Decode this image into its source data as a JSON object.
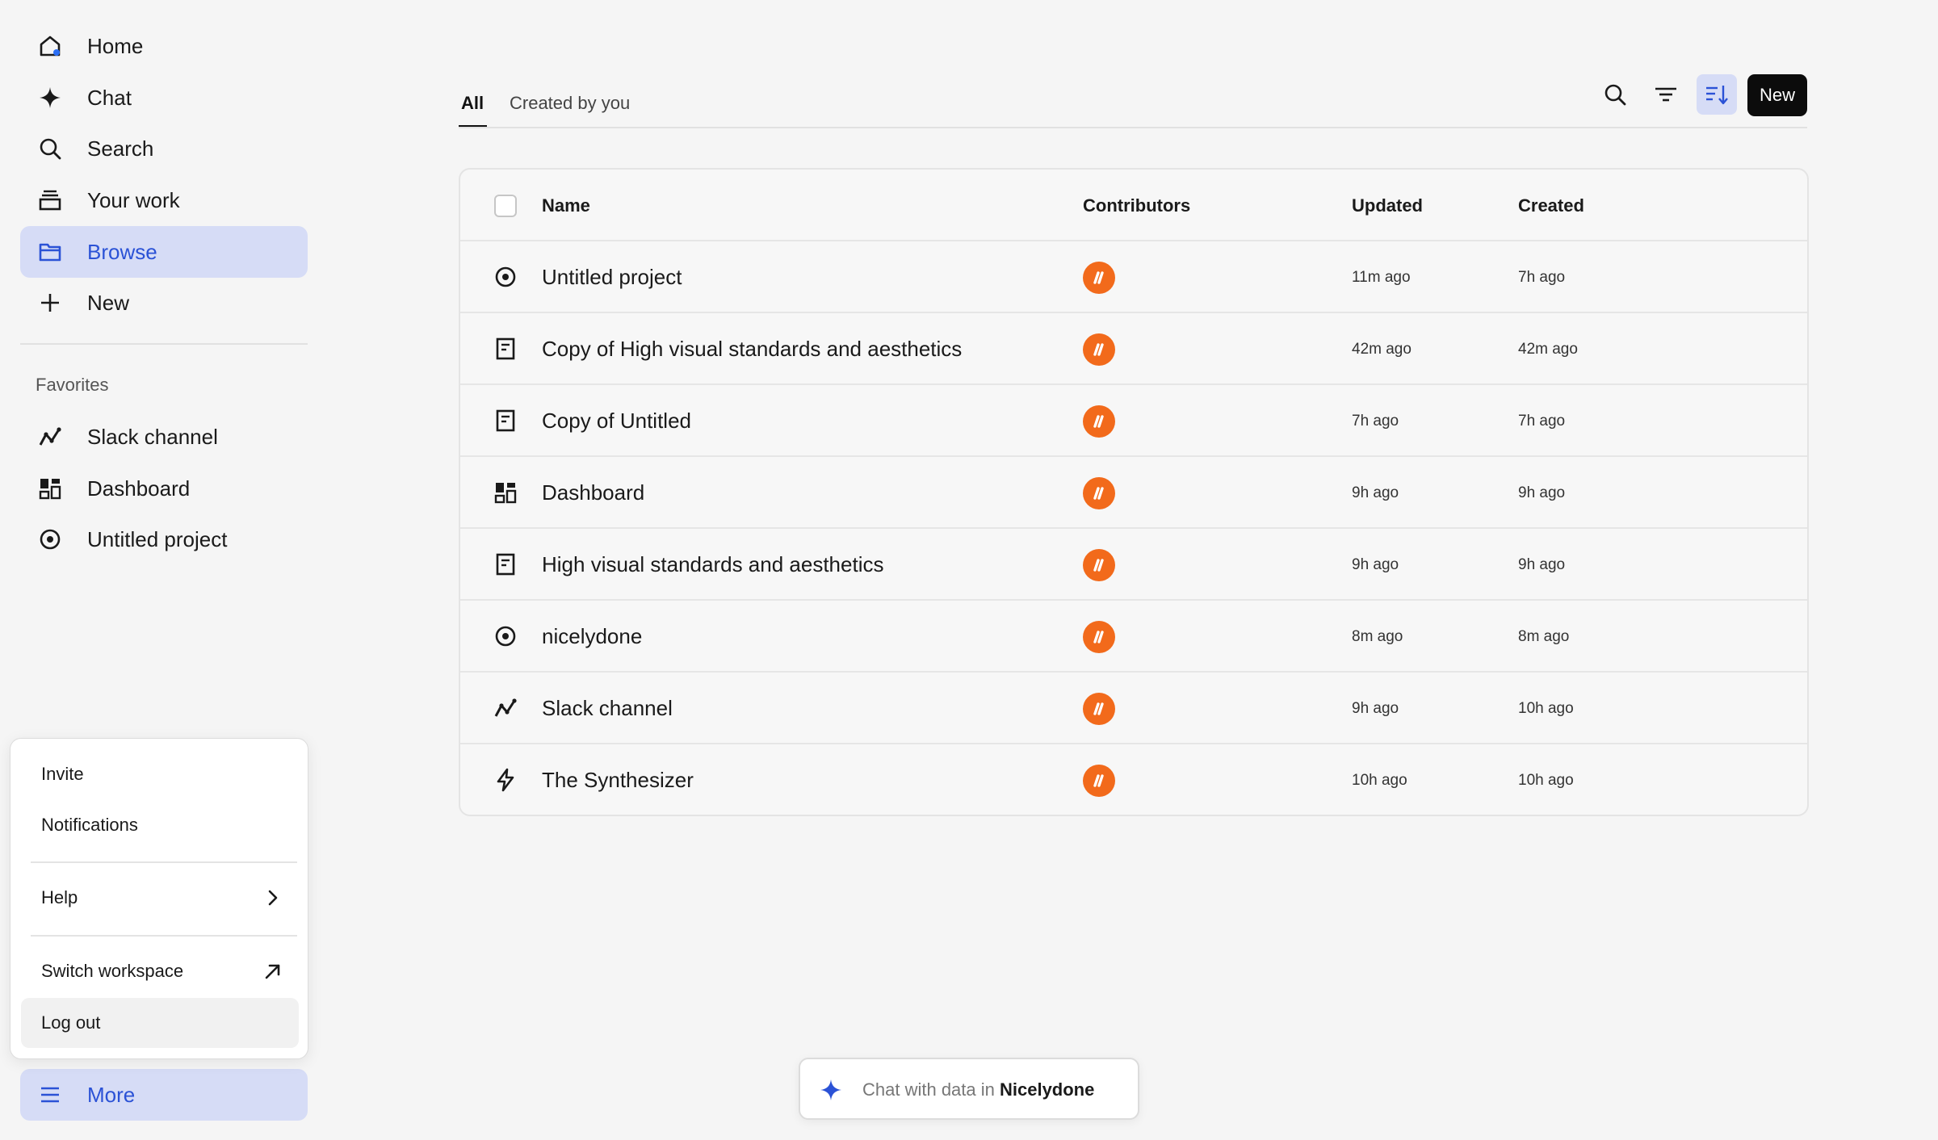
{
  "sidebar": {
    "nav": [
      {
        "label": "Home",
        "icon": "home-icon"
      },
      {
        "label": "Chat",
        "icon": "sparkle-icon"
      },
      {
        "label": "Search",
        "icon": "search-icon"
      },
      {
        "label": "Your work",
        "icon": "stack-icon"
      },
      {
        "label": "Browse",
        "icon": "folder-icon",
        "active": true
      },
      {
        "label": "New",
        "icon": "plus-icon"
      }
    ],
    "favorites_header": "Favorites",
    "favorites": [
      {
        "label": "Slack channel",
        "icon": "chart-line-icon"
      },
      {
        "label": "Dashboard",
        "icon": "dashboard-icon"
      },
      {
        "label": "Untitled project",
        "icon": "compass-icon"
      }
    ],
    "more_label": "More"
  },
  "menu": {
    "items": [
      {
        "label": "Invite"
      },
      {
        "label": "Notifications"
      },
      {
        "label": "Help",
        "trail": "chevron-right-icon"
      },
      {
        "label": "Switch workspace",
        "trail": "arrow-up-right-icon"
      },
      {
        "label": "Log out"
      }
    ]
  },
  "tabs": [
    {
      "label": "All",
      "active": true
    },
    {
      "label": "Created by you",
      "active": false
    }
  ],
  "toolbar": {
    "new_label": "New",
    "buttons": [
      "search-icon",
      "filter-icon",
      "sort-icon"
    ]
  },
  "table": {
    "headers": {
      "name": "Name",
      "contributors": "Contributors",
      "updated": "Updated",
      "created": "Created"
    },
    "rows": [
      {
        "icon": "compass-icon",
        "name": "Untitled project",
        "updated": "11m ago",
        "created": "7h ago"
      },
      {
        "icon": "document-icon",
        "name": "Copy of High visual standards and aesthetics",
        "updated": "42m ago",
        "created": "42m ago"
      },
      {
        "icon": "document-icon",
        "name": "Copy of Untitled",
        "updated": "7h ago",
        "created": "7h ago"
      },
      {
        "icon": "dashboard-icon",
        "name": "Dashboard",
        "updated": "9h ago",
        "created": "9h ago"
      },
      {
        "icon": "document-icon",
        "name": "High visual standards and aesthetics",
        "updated": "9h ago",
        "created": "9h ago"
      },
      {
        "icon": "compass-icon",
        "name": "nicelydone",
        "updated": "8m ago",
        "created": "8m ago"
      },
      {
        "icon": "chart-line-icon",
        "name": "Slack channel",
        "updated": "9h ago",
        "created": "10h ago"
      },
      {
        "icon": "lightning-icon",
        "name": "The Synthesizer",
        "updated": "10h ago",
        "created": "10h ago"
      }
    ]
  },
  "chat": {
    "prefix": "Chat with data in ",
    "workspace": "Nicelydone"
  },
  "colors": {
    "accent": "#2b52d6",
    "accent_bg": "#d6dcf6",
    "avatar": "#f26a1b"
  }
}
